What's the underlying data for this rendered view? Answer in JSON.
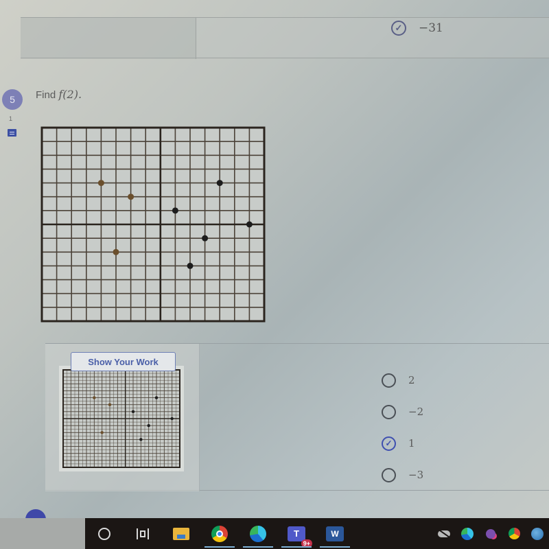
{
  "previous_question": {
    "selected_answer": "−31",
    "selected_icon": "check-circle-icon"
  },
  "question": {
    "number": "5",
    "points": "1",
    "prompt_prefix": "Find ",
    "prompt_math": "f(2).",
    "note_icon": "notes-icon"
  },
  "graph": {
    "x_range": [
      -8,
      7
    ],
    "y_range": [
      -7,
      7
    ],
    "grid": true,
    "points": [
      {
        "x": -4,
        "y": 3
      },
      {
        "x": -2,
        "y": 2
      },
      {
        "x": -3,
        "y": -2
      },
      {
        "x": 1,
        "y": 1
      },
      {
        "x": 4,
        "y": 3
      },
      {
        "x": 6,
        "y": 0
      },
      {
        "x": 3,
        "y": -1
      },
      {
        "x": 2,
        "y": -3
      }
    ],
    "colors": {
      "left_points": "#6b4f2c",
      "right_points": "#1d1d1d",
      "grid_line": "#4b4238",
      "axis_line": "#2a241e",
      "background": "#c8ccc9"
    }
  },
  "answer": {
    "show_work_label": "Show Your Work",
    "options": [
      {
        "label": "2",
        "selected": false
      },
      {
        "label": "−2",
        "selected": false
      },
      {
        "label": "1",
        "selected": true
      },
      {
        "label": "−3",
        "selected": false
      }
    ],
    "selected_color": "#3e4fb0"
  },
  "taskbar": {
    "items": [
      {
        "name": "search",
        "icon": "search-circle-icon",
        "active": false
      },
      {
        "name": "task-view",
        "icon": "task-view-icon",
        "active": false
      },
      {
        "name": "file-explorer",
        "icon": "folder-icon",
        "active": false
      },
      {
        "name": "chrome",
        "icon": "chrome-icon",
        "active": true
      },
      {
        "name": "edge",
        "icon": "edge-icon",
        "active": true
      },
      {
        "name": "teams",
        "icon": "teams-icon",
        "active": true,
        "badge": "9+"
      },
      {
        "name": "word",
        "icon": "word-icon",
        "active": true
      }
    ],
    "tray": [
      {
        "name": "onedrive-offline",
        "icon": "cloud-off-icon"
      },
      {
        "name": "edge-tray",
        "icon": "edge-icon"
      },
      {
        "name": "teams-tray",
        "icon": "teams-icon"
      },
      {
        "name": "chrome-tray",
        "icon": "chrome-icon"
      },
      {
        "name": "network",
        "icon": "globe-icon"
      }
    ]
  }
}
